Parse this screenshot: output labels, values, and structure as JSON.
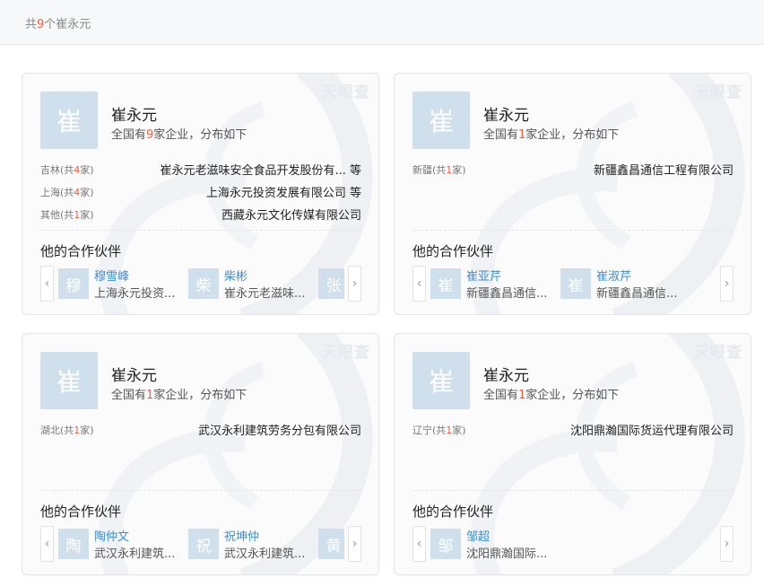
{
  "header": {
    "prefix": "共",
    "count": "9",
    "suffix": "个崔永元"
  },
  "summary_prefix": "全国有",
  "summary_suffix": "家企业，分布如下",
  "partners_title": "他的合作伙伴",
  "watermark": "天眼查",
  "cards": [
    {
      "avatar": "崔",
      "name": "崔永元",
      "total": "9",
      "rows": [
        {
          "region": "吉林",
          "count": "4",
          "company": "崔永元老滋味安全食品开发股份有... 等"
        },
        {
          "region": "上海",
          "count": "4",
          "company": "上海永元投资发展有限公司 等"
        },
        {
          "region": "其他",
          "count": "1",
          "company": "西藏永元文化传媒有限公司"
        }
      ],
      "partners": [
        {
          "avatar": "穆",
          "name": "穆雪峰",
          "company": "上海永元投资..."
        },
        {
          "avatar": "柴",
          "name": "柴彬",
          "company": "崔永元老滋味..."
        },
        {
          "avatar": "张",
          "name": "",
          "company": ""
        }
      ]
    },
    {
      "avatar": "崔",
      "name": "崔永元",
      "total": "1",
      "rows": [
        {
          "region": "新疆",
          "count": "1",
          "company": "新疆鑫昌通信工程有限公司"
        }
      ],
      "partners": [
        {
          "avatar": "崔",
          "name": "崔亚芹",
          "company": "新疆鑫昌通信..."
        },
        {
          "avatar": "崔",
          "name": "崔淑芹",
          "company": "新疆鑫昌通信..."
        }
      ]
    },
    {
      "avatar": "崔",
      "name": "崔永元",
      "total": "1",
      "rows": [
        {
          "region": "湖北",
          "count": "1",
          "company": "武汉永利建筑劳务分包有限公司"
        }
      ],
      "partners": [
        {
          "avatar": "陶",
          "name": "陶仲文",
          "company": "武汉永利建筑..."
        },
        {
          "avatar": "祝",
          "name": "祝坤仲",
          "company": "武汉永利建筑..."
        },
        {
          "avatar": "黄",
          "name": "",
          "company": ""
        }
      ]
    },
    {
      "avatar": "崔",
      "name": "崔永元",
      "total": "1",
      "rows": [
        {
          "region": "辽宁",
          "count": "1",
          "company": "沈阳鼎瀚国际货运代理有限公司"
        }
      ],
      "partners": [
        {
          "avatar": "邹",
          "name": "邹超",
          "company": "沈阳鼎瀚国际..."
        }
      ]
    }
  ],
  "colors": {
    "accent": "#ff5a36",
    "link": "#3d8dd6",
    "avatar_bg": "#cfe0ec"
  },
  "icons": {
    "prev": "chevron-left-icon",
    "next": "chevron-right-icon"
  }
}
